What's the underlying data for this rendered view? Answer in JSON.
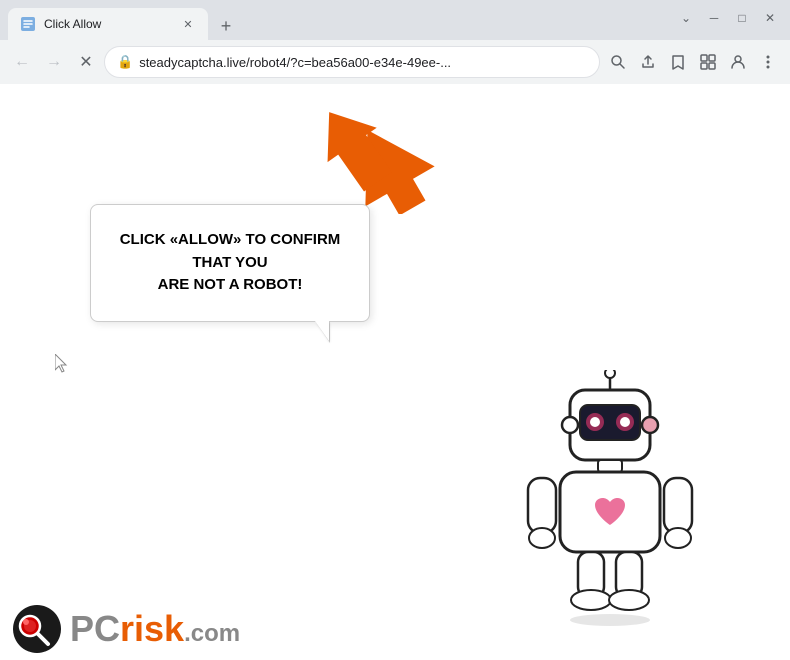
{
  "window": {
    "title": "Click Allow",
    "controls": {
      "minimize": "─",
      "maximize": "□",
      "close": "✕"
    }
  },
  "tabs": [
    {
      "label": "Click Allow",
      "active": true
    }
  ],
  "new_tab_label": "+",
  "toolbar": {
    "back_label": "←",
    "forward_label": "→",
    "reload_label": "✕",
    "address": "steadycaptcha.live/robot4/?c=bea56a00-e34e-49ee-...",
    "search_icon": "🔍",
    "share_icon": "⎙",
    "bookmark_icon": "☆",
    "extensions_icon": "⬛",
    "profile_icon": "👤",
    "menu_icon": "⋮"
  },
  "page": {
    "bubble_text_line1": "CLICK «ALLOW» TO CONFIRM THAT YOU",
    "bubble_text_line2": "ARE NOT A ROBOT!"
  },
  "pcrisk": {
    "pc": "PC",
    "risk": "risk",
    "com": ".com"
  }
}
